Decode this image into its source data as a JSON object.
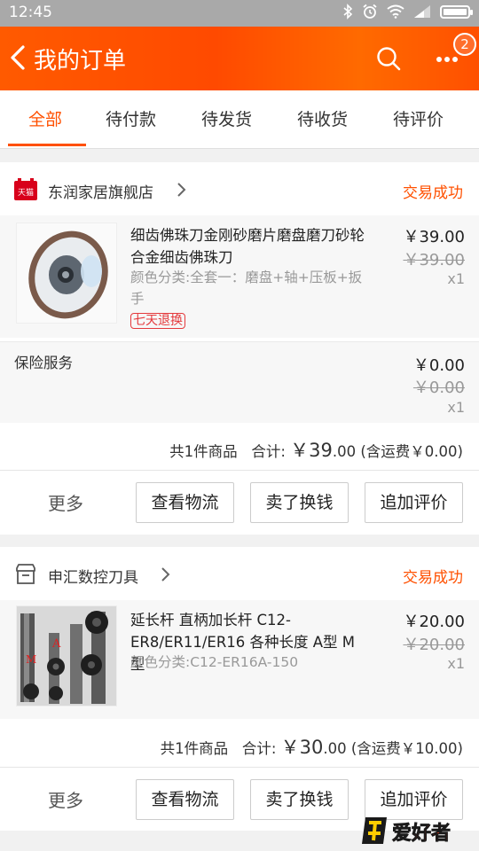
{
  "statusbar": {
    "time": "12:45"
  },
  "header": {
    "title": "我的订单",
    "badge_count": "2"
  },
  "tabs": [
    {
      "label": "全部",
      "active": true
    },
    {
      "label": "待付款"
    },
    {
      "label": "待发货"
    },
    {
      "label": "待收货"
    },
    {
      "label": "待评价"
    }
  ],
  "orders": [
    {
      "shop_name": "东润家居旗舰店",
      "shop_badge": "天猫",
      "status": "交易成功",
      "item": {
        "title": "细齿佛珠刀金刚砂磨片磨盘磨刀砂轮合金细齿佛珠刀",
        "spec": "颜色分类:全套一：磨盘+轴+压板+扳手",
        "tag": "七天退换",
        "price": "￥39.00",
        "original_price": "￥39.00",
        "qty": "x1"
      },
      "insurance": {
        "label": "保险服务",
        "price": "￥0.00",
        "original_price": "￥0.00",
        "qty": "x1"
      },
      "summary": {
        "count": "共1件商品",
        "total_label": "合计:",
        "total_yuan": "￥39",
        "total_cents": ".00",
        "shipping": "(含运费￥0.00)"
      },
      "actions": {
        "more": "更多",
        "logistics": "查看物流",
        "resell": "卖了换钱",
        "review": "追加评价"
      }
    },
    {
      "shop_name": "申汇数控刀具",
      "status": "交易成功",
      "item": {
        "title": "延长杆 直柄加长杆 C12-ER8/ER11/ER16 各种长度 A型 M型",
        "spec": "颜色分类:C12-ER16A-150",
        "price": "￥20.00",
        "original_price": "￥20.00",
        "qty": "x1",
        "image_labels": {
          "a": "A",
          "m": "M"
        }
      },
      "summary": {
        "count": "共1件商品",
        "total_label": "合计:",
        "total_yuan": "￥30",
        "total_cents": ".00",
        "shipping": "(含运费￥10.00)"
      },
      "actions": {
        "more": "更多",
        "logistics": "查看物流",
        "resell": "卖了换钱",
        "review": "追加评价"
      }
    }
  ],
  "watermark": "爱好者",
  "colors": {
    "accent": "#ff5000",
    "header_gradient_start": "#ff5a00",
    "tag_red": "#e4393c"
  }
}
